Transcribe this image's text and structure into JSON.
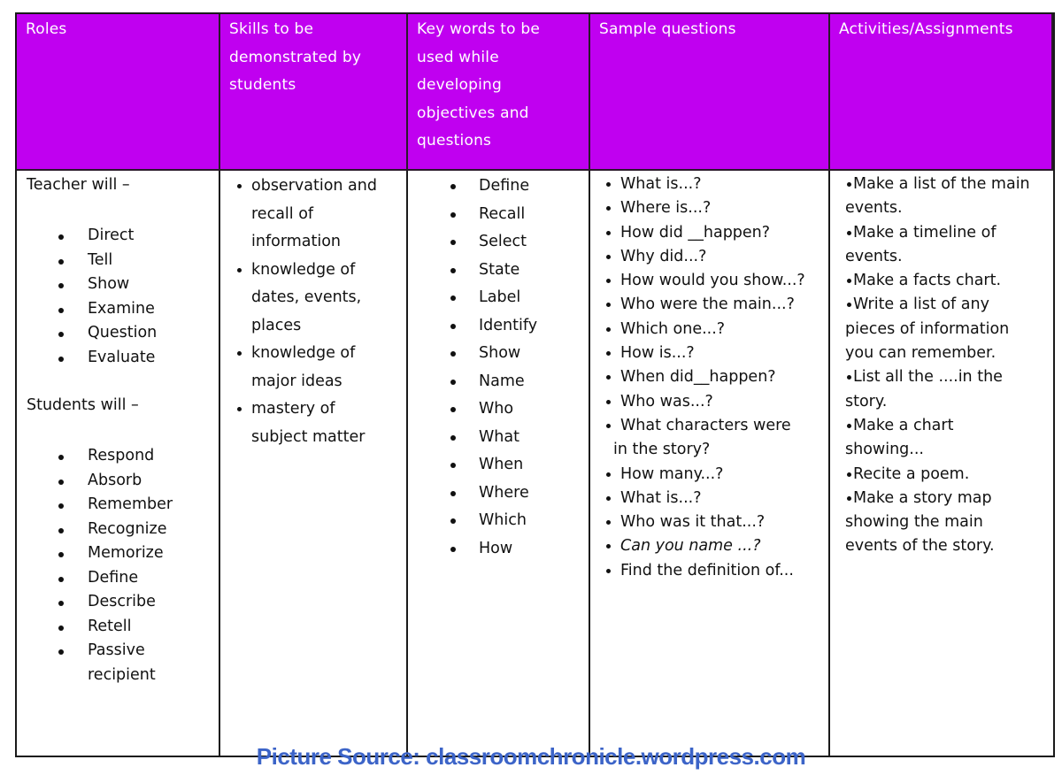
{
  "colors": {
    "header_bg": "#c000f0",
    "header_text": "#ffffff",
    "border": "#1a1a1a",
    "watermark": "#3c64c8"
  },
  "headers": [
    "Roles",
    "Skills to be demonstrated by students",
    "Key words to be used while developing objectives and questions",
    "Sample questions",
    "Activities/Assignments"
  ],
  "roles": {
    "teacher_heading": "Teacher will –",
    "teacher_items": [
      "Direct",
      "Tell",
      "Show",
      "Examine",
      "Question",
      "Evaluate"
    ],
    "students_heading": "Students will –",
    "student_items": [
      "Respond",
      "Absorb",
      "Remember",
      "Recognize",
      "Memorize",
      "Define",
      "Describe",
      "Retell",
      "Passive recipient"
    ]
  },
  "skills": [
    "observation and recall of information",
    "knowledge of dates, events, places",
    "knowledge of major ideas",
    "mastery of subject matter"
  ],
  "keywords": [
    "Define",
    "Recall",
    "Select",
    "State",
    "Label",
    "Identify",
    "Show",
    "Name",
    "Who",
    "What",
    "When",
    "Where",
    "Which",
    "How"
  ],
  "questions": [
    "What is...?",
    "Where is...?",
    "How did __happen?",
    "Why did...?",
    "How would you show...?",
    "Who were the main...?",
    "Which one...?",
    "How is...?",
    "When did__happen?",
    "Who was...?",
    "What characters were",
    "in the story?",
    "How many...?",
    "What is...?",
    "Who was it that...?",
    "Can you name ...?",
    "Find the definition of..."
  ],
  "activities": [
    "Make a list of the main events.",
    "Make a timeline of events.",
    "Make a facts chart.",
    "Write a list of any pieces of information you can remember.",
    "List all the ....in the story.",
    "Make a chart showing...",
    "Recite a poem.",
    "Make a story map showing the main events of the story."
  ],
  "watermark": "Picture Source: classroomchronicle.wordpress.com"
}
